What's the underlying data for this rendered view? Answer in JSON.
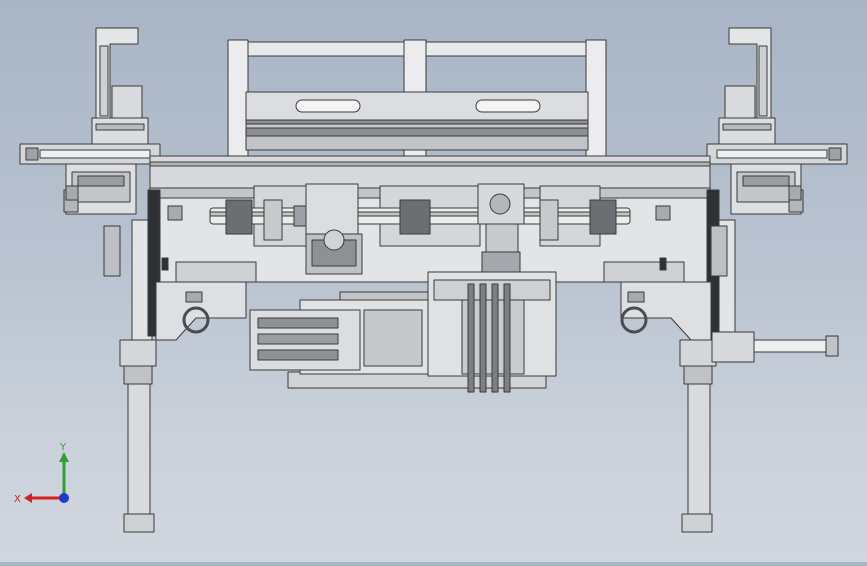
{
  "viewport": {
    "background_top": "#a9b5c6",
    "background_bottom": "#d2d7df",
    "model_edge_color": "#3a3a3a",
    "model_fill_light": "#e8e8ea",
    "model_fill_mid": "#c9cacd",
    "model_fill_dark": "#8e9095"
  },
  "triad": {
    "y_label": "Y",
    "x_label": "X",
    "y_color": "#2fa02f",
    "x_color": "#d42020",
    "z_color": "#1a3cc8"
  }
}
